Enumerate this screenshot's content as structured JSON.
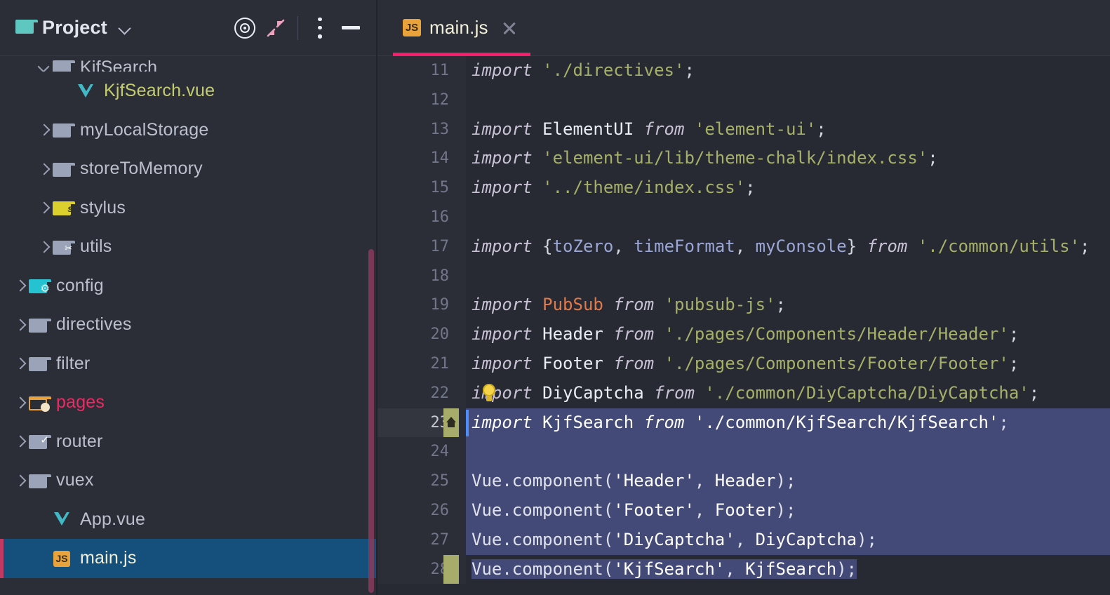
{
  "window": {
    "panel_title": "Project",
    "folder_icon": "folder-icon",
    "dropdown_icon": "chevron-down-icon",
    "toolbar_buttons": [
      {
        "name": "locate-target-icon",
        "label": "Select Opened File"
      },
      {
        "name": "collapse-all-icon",
        "label": "Collapse All"
      },
      {
        "name": "options-menu-icon",
        "label": "Options"
      },
      {
        "name": "minimize-icon",
        "label": "Hide"
      }
    ]
  },
  "sidebar": {
    "scrollbar_color": "#8a3a5c",
    "selected_item": "main.js",
    "items": [
      {
        "label": "KjfSearch",
        "type": "folder",
        "icon": "folder-gray-icon",
        "indent": 0,
        "expanded": true,
        "arrow": "down",
        "color": "#bcc0cd",
        "clipped": true
      },
      {
        "label": "KjfSearch.vue",
        "type": "file",
        "icon": "vue-file-icon",
        "indent": 1,
        "expanded": false,
        "arrow": "none",
        "color": "#c4cc72",
        "clipped": false
      },
      {
        "label": "myLocalStorage",
        "type": "folder",
        "icon": "folder-gray-icon",
        "indent": 0,
        "expanded": false,
        "arrow": "right",
        "color": "#bcc0cd",
        "clipped": false
      },
      {
        "label": "storeToMemory",
        "type": "folder",
        "icon": "folder-gray-icon",
        "indent": 0,
        "expanded": false,
        "arrow": "right",
        "color": "#bcc0cd",
        "clipped": false
      },
      {
        "label": "stylus",
        "type": "folder",
        "icon": "folder-stylus-icon",
        "indent": 0,
        "expanded": false,
        "arrow": "right",
        "color": "#bcc0cd",
        "clipped": false
      },
      {
        "label": "utils",
        "type": "folder",
        "icon": "folder-js-icon",
        "indent": 0,
        "expanded": false,
        "arrow": "right",
        "color": "#bcc0cd",
        "clipped": false
      },
      {
        "label": "config",
        "type": "folder",
        "icon": "folder-config-icon",
        "indent": -1,
        "expanded": false,
        "arrow": "right",
        "color": "#bcc0cd",
        "clipped": false
      },
      {
        "label": "directives",
        "type": "folder",
        "icon": "folder-gray-icon",
        "indent": -1,
        "expanded": false,
        "arrow": "right",
        "color": "#bcc0cd",
        "clipped": false
      },
      {
        "label": "filter",
        "type": "folder",
        "icon": "folder-gray-icon",
        "indent": -1,
        "expanded": false,
        "arrow": "right",
        "color": "#bcc0cd",
        "clipped": false
      },
      {
        "label": "pages",
        "type": "folder",
        "icon": "folder-pages-icon",
        "indent": -1,
        "expanded": false,
        "arrow": "right",
        "color": "#ef2a63",
        "clipped": false
      },
      {
        "label": "router",
        "type": "folder",
        "icon": "folder-router-icon",
        "indent": -1,
        "expanded": false,
        "arrow": "right",
        "color": "#bcc0cd",
        "clipped": false
      },
      {
        "label": "vuex",
        "type": "folder",
        "icon": "folder-gray-icon",
        "indent": -1,
        "expanded": false,
        "arrow": "right",
        "color": "#bcc0cd",
        "clipped": false
      },
      {
        "label": "App.vue",
        "type": "file",
        "icon": "vue-file-icon",
        "indent": 0,
        "expanded": false,
        "arrow": "none",
        "color": "#bcc0cd",
        "clipped": false
      },
      {
        "label": "main.js",
        "type": "file",
        "icon": "js-file-icon",
        "indent": 0,
        "expanded": false,
        "arrow": "none",
        "color": "#f3f0d9",
        "clipped": false
      }
    ]
  },
  "editor": {
    "tab": {
      "label": "main.js",
      "icon": "js-file-icon",
      "close_icon": "close-icon",
      "underline_color": "#f2206a",
      "active": true
    },
    "selection_color": "#444a77",
    "current_line": 23,
    "bulb_line": 22,
    "bookmark_lines": [
      23,
      28
    ],
    "lines": [
      {
        "num": 11,
        "selected": false,
        "tokens": [
          {
            "t": "import",
            "c": "kw"
          },
          {
            "t": " ",
            "c": "dot"
          },
          {
            "t": "'./directives'",
            "c": "str"
          },
          {
            "t": ";",
            "c": "punct"
          }
        ]
      },
      {
        "num": 12,
        "selected": false,
        "tokens": []
      },
      {
        "num": 13,
        "selected": false,
        "tokens": [
          {
            "t": "import",
            "c": "kw"
          },
          {
            "t": " ",
            "c": "dot"
          },
          {
            "t": "ElementUI",
            "c": "id"
          },
          {
            "t": " ",
            "c": "dot"
          },
          {
            "t": "from",
            "c": "kw"
          },
          {
            "t": " ",
            "c": "dot"
          },
          {
            "t": "'element-ui'",
            "c": "str"
          },
          {
            "t": ";",
            "c": "punct"
          }
        ]
      },
      {
        "num": 14,
        "selected": false,
        "tokens": [
          {
            "t": "import",
            "c": "kw"
          },
          {
            "t": " ",
            "c": "dot"
          },
          {
            "t": "'element-ui/lib/theme-chalk/index.css'",
            "c": "str"
          },
          {
            "t": ";",
            "c": "punct"
          }
        ]
      },
      {
        "num": 15,
        "selected": false,
        "tokens": [
          {
            "t": "import",
            "c": "kw"
          },
          {
            "t": " ",
            "c": "dot"
          },
          {
            "t": "'../theme/index.css'",
            "c": "str"
          },
          {
            "t": ";",
            "c": "punct"
          }
        ]
      },
      {
        "num": 16,
        "selected": false,
        "tokens": []
      },
      {
        "num": 17,
        "selected": false,
        "tokens": [
          {
            "t": "import",
            "c": "kw"
          },
          {
            "t": " ",
            "c": "dot"
          },
          {
            "t": "{",
            "c": "punct"
          },
          {
            "t": "toZero",
            "c": "id2"
          },
          {
            "t": ", ",
            "c": "punct"
          },
          {
            "t": "timeFormat",
            "c": "id2"
          },
          {
            "t": ", ",
            "c": "punct"
          },
          {
            "t": "myConsole",
            "c": "id2"
          },
          {
            "t": "}",
            "c": "punct"
          },
          {
            "t": " ",
            "c": "dot"
          },
          {
            "t": "from",
            "c": "kw"
          },
          {
            "t": " ",
            "c": "dot"
          },
          {
            "t": "'./common/utils'",
            "c": "str"
          },
          {
            "t": ";",
            "c": "punct"
          }
        ]
      },
      {
        "num": 18,
        "selected": false,
        "tokens": []
      },
      {
        "num": 19,
        "selected": false,
        "tokens": [
          {
            "t": "import",
            "c": "kw"
          },
          {
            "t": " ",
            "c": "dot"
          },
          {
            "t": "PubSub",
            "c": "warn"
          },
          {
            "t": " ",
            "c": "dot"
          },
          {
            "t": "from",
            "c": "kw"
          },
          {
            "t": " ",
            "c": "dot"
          },
          {
            "t": "'pubsub-js'",
            "c": "str"
          },
          {
            "t": ";",
            "c": "punct"
          }
        ]
      },
      {
        "num": 20,
        "selected": false,
        "tokens": [
          {
            "t": "import",
            "c": "kw"
          },
          {
            "t": " ",
            "c": "dot"
          },
          {
            "t": "Header",
            "c": "id"
          },
          {
            "t": " ",
            "c": "dot"
          },
          {
            "t": "from",
            "c": "kw"
          },
          {
            "t": " ",
            "c": "dot"
          },
          {
            "t": "'./pages/Components/Header/Header'",
            "c": "str"
          },
          {
            "t": ";",
            "c": "punct"
          }
        ]
      },
      {
        "num": 21,
        "selected": false,
        "tokens": [
          {
            "t": "import",
            "c": "kw"
          },
          {
            "t": " ",
            "c": "dot"
          },
          {
            "t": "Footer",
            "c": "id"
          },
          {
            "t": " ",
            "c": "dot"
          },
          {
            "t": "from",
            "c": "kw"
          },
          {
            "t": " ",
            "c": "dot"
          },
          {
            "t": "'./pages/Components/Footer/Footer'",
            "c": "str"
          },
          {
            "t": ";",
            "c": "punct"
          }
        ]
      },
      {
        "num": 22,
        "selected": false,
        "tokens": [
          {
            "t": "import",
            "c": "kw"
          },
          {
            "t": " ",
            "c": "dot"
          },
          {
            "t": "DiyCaptcha",
            "c": "id"
          },
          {
            "t": " ",
            "c": "dot"
          },
          {
            "t": "from",
            "c": "kw"
          },
          {
            "t": " ",
            "c": "dot"
          },
          {
            "t": "'./common/DiyCaptcha/DiyCaptcha'",
            "c": "str"
          },
          {
            "t": ";",
            "c": "punct"
          }
        ]
      },
      {
        "num": 23,
        "selected": true,
        "tokens": [
          {
            "t": "import",
            "c": "kw"
          },
          {
            "t": " ",
            "c": "dot"
          },
          {
            "t": "KjfSearch",
            "c": "id"
          },
          {
            "t": " ",
            "c": "dot"
          },
          {
            "t": "from",
            "c": "kw"
          },
          {
            "t": " ",
            "c": "dot"
          },
          {
            "t": "'./common/KjfSearch/KjfSearch'",
            "c": "str"
          },
          {
            "t": ";",
            "c": "punct"
          }
        ]
      },
      {
        "num": 24,
        "selected": true,
        "tokens": []
      },
      {
        "num": 25,
        "selected": true,
        "tokens": [
          {
            "t": "Vue.component(",
            "c": "plain"
          },
          {
            "t": "'Header'",
            "c": "str"
          },
          {
            "t": ", ",
            "c": "plain"
          },
          {
            "t": "Header",
            "c": "id"
          },
          {
            "t": ");",
            "c": "plain"
          }
        ]
      },
      {
        "num": 26,
        "selected": true,
        "tokens": [
          {
            "t": "Vue.component(",
            "c": "plain"
          },
          {
            "t": "'Footer'",
            "c": "str"
          },
          {
            "t": ", ",
            "c": "plain"
          },
          {
            "t": "Footer",
            "c": "id"
          },
          {
            "t": ");",
            "c": "plain"
          }
        ]
      },
      {
        "num": 27,
        "selected": true,
        "tokens": [
          {
            "t": "Vue.component(",
            "c": "plain"
          },
          {
            "t": "'DiyCaptcha'",
            "c": "str"
          },
          {
            "t": ", ",
            "c": "plain"
          },
          {
            "t": "DiyCaptcha",
            "c": "id"
          },
          {
            "t": ");",
            "c": "plain"
          }
        ]
      },
      {
        "num": 28,
        "selected": true,
        "partial": true,
        "tokens": [
          {
            "t": "Vue.component(",
            "c": "plain"
          },
          {
            "t": "'KjfSearch'",
            "c": "str"
          },
          {
            "t": ", ",
            "c": "plain"
          },
          {
            "t": "KjfSearch",
            "c": "id"
          },
          {
            "t": ");",
            "c": "plain"
          }
        ]
      }
    ]
  }
}
